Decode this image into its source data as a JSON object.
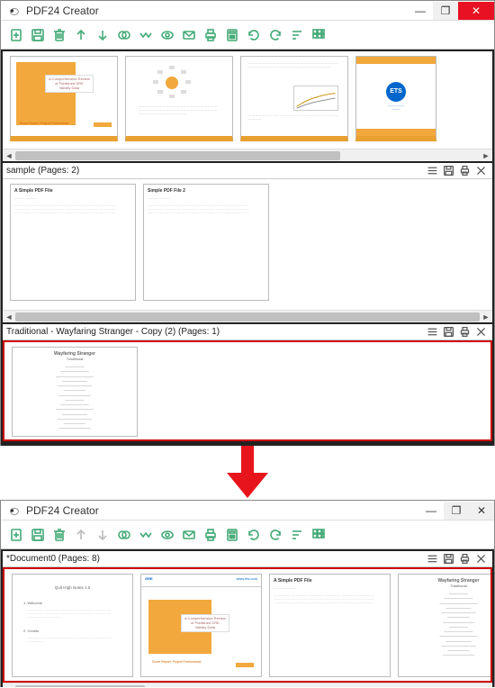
{
  "app": {
    "title": "PDF24 Creator"
  },
  "toolbar": [
    {
      "name": "add",
      "icon": "plus-file"
    },
    {
      "name": "save",
      "icon": "save"
    },
    {
      "name": "delete",
      "icon": "trash"
    },
    {
      "name": "up",
      "icon": "arrow-up"
    },
    {
      "name": "down",
      "icon": "arrow-down"
    },
    {
      "name": "join",
      "icon": "circles"
    },
    {
      "name": "split",
      "icon": "zigzag"
    },
    {
      "name": "view",
      "icon": "eye"
    },
    {
      "name": "mail",
      "icon": "mail"
    },
    {
      "name": "print",
      "icon": "print"
    },
    {
      "name": "fax",
      "icon": "calc"
    },
    {
      "name": "rotate-left",
      "icon": "rotate-ccw"
    },
    {
      "name": "rotate-right",
      "icon": "rotate-cw"
    },
    {
      "name": "sort",
      "icon": "sort"
    },
    {
      "name": "grid",
      "icon": "grid"
    }
  ],
  "window1": {
    "docs": [
      {
        "name_not_shown": "",
        "selected": false,
        "orange_style": true,
        "thumbs": [
          {
            "w": 120,
            "h": 95,
            "kind": "cover-orange",
            "title_lines": [
              "A Comprehensive Review",
              "of Published GRE",
              "Validity Data"
            ],
            "footer": "Score Report: Project Performance"
          },
          {
            "w": 120,
            "h": 95,
            "kind": "diagram-text"
          },
          {
            "w": 120,
            "h": 95,
            "kind": "text-chart"
          },
          {
            "w": 90,
            "h": 95,
            "kind": "ets-logo",
            "logo_text": "ETS"
          }
        ],
        "scroll": {
          "pos": 0,
          "width": 70
        }
      },
      {
        "name": "sample (Pages: 2)",
        "selected": false,
        "thumbs": [
          {
            "w": 140,
            "h": 130,
            "kind": "simple-text",
            "title": "A Simple PDF File"
          },
          {
            "w": 140,
            "h": 130,
            "kind": "simple-text",
            "title": "Simple PDF File 2"
          }
        ],
        "scroll": {
          "pos": 0,
          "width": 100
        }
      },
      {
        "name": "Traditional - Wayfaring Stranger - Copy (2) (Pages: 1)",
        "selected": true,
        "thumbs": [
          {
            "w": 140,
            "h": 100,
            "kind": "lyrics",
            "title": "Wayfaring Stranger",
            "sub": "Traditional"
          }
        ]
      }
    ]
  },
  "window2": {
    "toolbar_disabled": [
      "up",
      "down"
    ],
    "docs": [
      {
        "name": "*Document0 (Pages: 8)",
        "selected": true,
        "thumbs": [
          {
            "w": 135,
            "h": 115,
            "kind": "text-page",
            "title": "Quit HIgh Notes 1.0",
            "sections": [
              "1. Welcome",
              "2. Credits"
            ]
          },
          {
            "w": 135,
            "h": 115,
            "kind": "cover-orange-2",
            "brand": "GRE",
            "url": "www.ets.com",
            "title_lines": [
              "A Comprehensive Review",
              "of Published GRE",
              "Validity Data"
            ],
            "footer": "Score Report: Project Performance"
          },
          {
            "w": 135,
            "h": 115,
            "kind": "simple-text",
            "title": "A Simple PDF File"
          },
          {
            "w": 135,
            "h": 115,
            "kind": "lyrics",
            "title": "Wayfaring Stranger",
            "sub": "Traditional"
          }
        ],
        "scroll": {
          "pos": 0,
          "width": 28
        }
      }
    ]
  }
}
